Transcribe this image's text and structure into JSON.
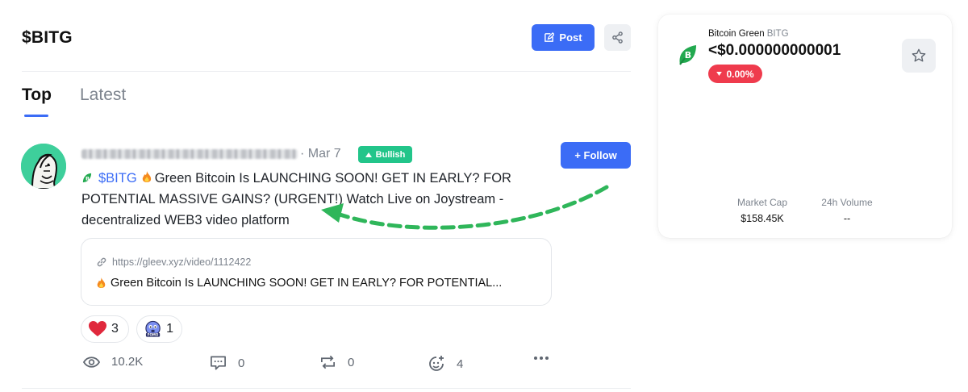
{
  "header": {
    "ticker": "$BITG",
    "post_label": "Post",
    "icons": {
      "post": "edit-icon",
      "share": "share-icon"
    }
  },
  "tabs": [
    {
      "label": "Top",
      "active": true
    },
    {
      "label": "Latest",
      "active": false
    }
  ],
  "post": {
    "date": "· Mar 7",
    "sentiment": "Bullish",
    "follow_label": "+ Follow",
    "cashtag": "$BITG",
    "body": "Green Bitcoin Is LAUNCHING SOON! GET IN EARLY? FOR POTENTIAL MASSIVE GAINS? (URGENT!) Watch Live on Joystream - decentralized WEB3 video platform",
    "link": {
      "url": "https://gleev.xyz/video/1112422",
      "title": "Green Bitcoin Is LAUNCHING SOON! GET IN EARLY? FOR POTENTIAL..."
    },
    "reactions": [
      {
        "icon": "heart-icon",
        "count": "3"
      },
      {
        "icon": "fomo-icon",
        "count": "1"
      }
    ],
    "actions": {
      "views": "10.2K",
      "comments": "0",
      "reposts": "0",
      "reactions": "4"
    }
  },
  "coin": {
    "name": "Bitcoin Green",
    "symbol": "BITG",
    "price": "<$0.000000000001",
    "change": "0.00%",
    "stats": [
      {
        "label": "Market Cap",
        "value": "$158.45K"
      },
      {
        "label": "24h Volume",
        "value": "--"
      }
    ]
  },
  "colors": {
    "accent": "#3b6cf6",
    "bullish": "#22c58a",
    "negative": "#ef3b4d",
    "annotation_arrow": "#2fb65a"
  }
}
